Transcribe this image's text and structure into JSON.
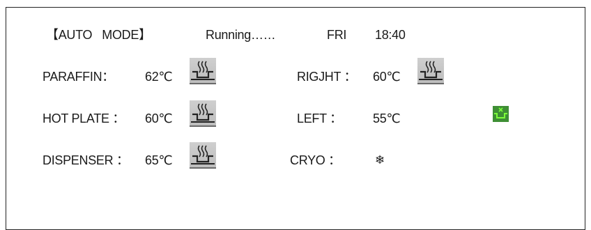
{
  "header": {
    "mode": "【AUTO   MODE】",
    "status": "Running……",
    "day": "FRI",
    "time": "18:40"
  },
  "left_column": [
    {
      "label": "PARAFFIN：",
      "value": "62℃",
      "icon": "heater-icon"
    },
    {
      "label": "HOT PLATE ：",
      "value": "60℃",
      "icon": "heater-icon"
    },
    {
      "label": "DISPENSER ：",
      "value": "65℃",
      "icon": "heater-icon"
    }
  ],
  "right_column": [
    {
      "label": "RIGJHT ：",
      "value": "60℃",
      "icon": "heater-icon"
    },
    {
      "label": "LEFT ：",
      "value": "55℃",
      "icon": "cooling-indicator-icon"
    },
    {
      "label": "CRYO ：",
      "value": "❄",
      "icon": "snowflake-icon"
    }
  ],
  "colors": {
    "border": "#222222",
    "icon_bg": "#bdbdbd",
    "indicator_green": "#3f8f35",
    "indicator_glyph": "#7dff3a"
  }
}
